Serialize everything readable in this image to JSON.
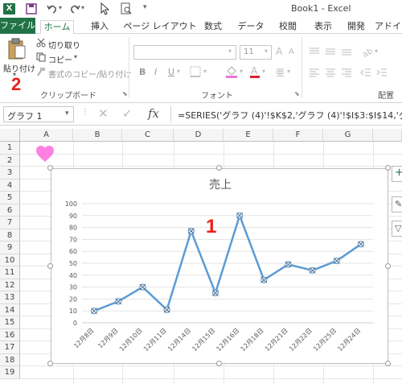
{
  "window": {
    "title": "Book1 - Excel"
  },
  "tabs": [
    "ファイル",
    "ホーム",
    "挿入",
    "ページ レイアウト",
    "数式",
    "データ",
    "校閲",
    "表示",
    "開発",
    "アドイ"
  ],
  "ribbon": {
    "paste_label": "貼り付け",
    "cut_label": "切り取り",
    "copy_label": "コピー",
    "format_painter_label": "書式のコピー/貼り付け",
    "clipboard_group": "クリップボード",
    "font_group": "フォント",
    "font_size": "11",
    "align_group_partial": "配置",
    "font_bold": "B",
    "font_italic": "I",
    "font_underline": "U"
  },
  "formula_bar": {
    "name_box": "グラフ 1",
    "fx_label": "fx",
    "formula": "=SERIES('グラフ (4)'!$K$2,'グラフ (4)'!$I$3:$I$14,'グラ"
  },
  "columns": [
    "A",
    "B",
    "C",
    "D",
    "E",
    "F",
    "G"
  ],
  "rows": [
    "1",
    "2",
    "3",
    "4",
    "5",
    "6",
    "7",
    "8",
    "9",
    "10",
    "11",
    "12",
    "13",
    "14",
    "15",
    "16",
    "17",
    "18",
    "19"
  ],
  "annotations": {
    "red_1": "1",
    "red_2": "2"
  },
  "colors": {
    "excel_green": "#217346",
    "series_line": "#5b9bd5",
    "annotation_red": "#e8201a",
    "heart": "#ff80e0"
  },
  "icons": [
    "excel-logo-icon",
    "save-icon",
    "undo-icon",
    "redo-icon",
    "pointer-icon",
    "print-preview-icon",
    "clipboard-icon",
    "scissors-icon",
    "copy-icon",
    "brush-icon",
    "heart-icon"
  ],
  "chart_data": {
    "type": "line",
    "title": "売上",
    "categories": [
      "12月8日",
      "12月9日",
      "12月10日",
      "12月11日",
      "12月14日",
      "12月15日",
      "12月16日",
      "12月18日",
      "12月21日",
      "12月22日",
      "12月25日",
      "12月24日"
    ],
    "values": [
      10,
      18,
      30,
      11,
      77,
      25,
      90,
      36,
      49,
      44,
      52,
      66
    ],
    "ylim": [
      0,
      100
    ],
    "yticks": [
      "0",
      "10",
      "20",
      "30",
      "40",
      "50",
      "60",
      "70",
      "80",
      "90",
      "100"
    ],
    "grid": true,
    "legend": "none"
  }
}
